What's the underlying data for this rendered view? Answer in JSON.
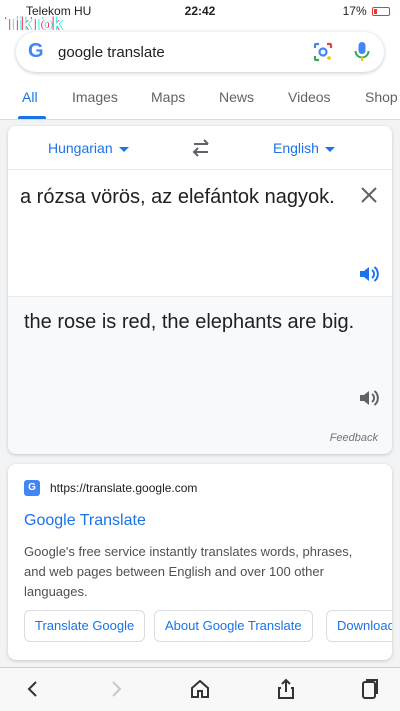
{
  "status": {
    "carrier": "Telekom HU",
    "time": "22:42",
    "battery": "17%"
  },
  "overlay": {
    "watermark": "TikTok"
  },
  "search": {
    "query": "google translate",
    "tabs": [
      "All",
      "Images",
      "Maps",
      "News",
      "Videos",
      "Shop"
    ],
    "active_tab": "All"
  },
  "translate": {
    "source_lang": "Hungarian",
    "target_lang": "English",
    "source_text": "a rózsa vörös, az elefántok nagyok.",
    "target_text": "the rose is red, the elephants are big.",
    "feedback": "Feedback"
  },
  "result": {
    "url": "https://translate.google.com",
    "title": "Google Translate",
    "snippet": "Google's free service instantly translates words, phrases, and web pages between English and over 100 other languages.",
    "chips": [
      "Translate Google",
      "About Google Translate",
      "Download"
    ]
  },
  "icons": {
    "lens": "lens-icon",
    "mic": "mic-icon",
    "swap": "swap-icon",
    "clear": "close-icon",
    "speaker": "speaker-icon",
    "back": "back-icon",
    "forward": "forward-icon",
    "home": "home-icon",
    "share": "share-icon",
    "tabs": "tabs-icon"
  },
  "colors": {
    "accent": "#1a73e8",
    "text": "#202124",
    "muted": "#5f6368"
  }
}
